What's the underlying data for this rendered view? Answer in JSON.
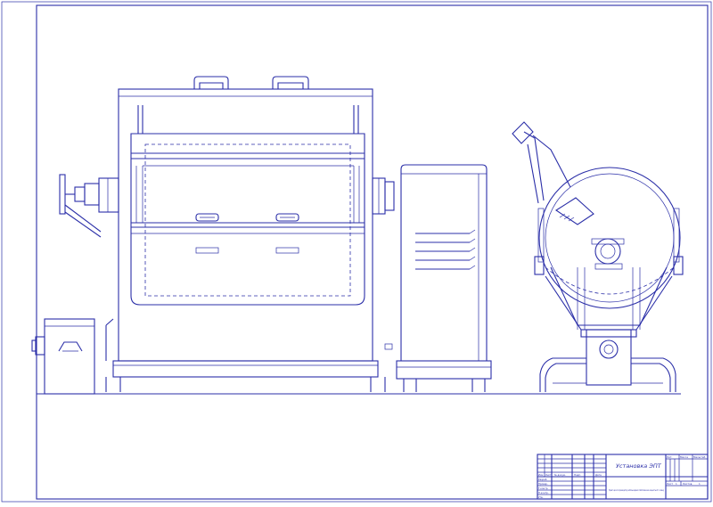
{
  "drawing": {
    "line_color": "#2b2fa8",
    "background": "#ffffff"
  },
  "title_block": {
    "drawing_title": "Установка ЭПТ",
    "note": "Проект цеха по производству колбасы вареной «Любительская» мощностью 6 т в смену",
    "sheet_label": "Лист",
    "sheets_label": "Листов",
    "stage_label": "Лит.",
    "mass_label": "Масса",
    "scale_label": "Масштаб",
    "sheet_number": "1",
    "sheets_total": "1",
    "role_rows": [
      "Разраб.",
      "Провер.",
      "Т.контр.",
      "Н.контр.",
      "Утв."
    ],
    "header_cells": [
      "Изм",
      "Лист",
      "№ докум.",
      "Подп.",
      "Дата"
    ]
  }
}
